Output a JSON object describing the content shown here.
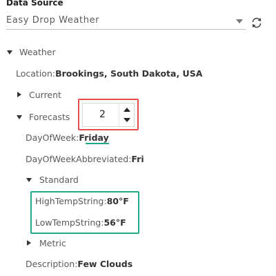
{
  "data_source": {
    "title": "Data Source",
    "selected": "Easy Drop Weather"
  },
  "tree": {
    "weather": "Weather",
    "location_label": "Location:",
    "location_value": "Brookings, South Dakota, USA",
    "current": "Current",
    "forecasts": "Forecasts",
    "forecast_index": "2",
    "day_of_week_label": "DayOfWeek:",
    "day_of_week_value": "Friday",
    "day_abbrev_label": "DayOfWeekAbbreviated:",
    "day_abbrev_value": "Fri",
    "standard": "Standard",
    "high_label": "HighTempString:",
    "high_value": "80°F",
    "low_label": "LowTempString:",
    "low_value": "56°F",
    "metric": "Metric",
    "description_label": "Description:",
    "description_value": "Few Clouds"
  },
  "colors": {
    "highlight_red": "#e74c4c",
    "highlight_green": "#1fa88a"
  }
}
